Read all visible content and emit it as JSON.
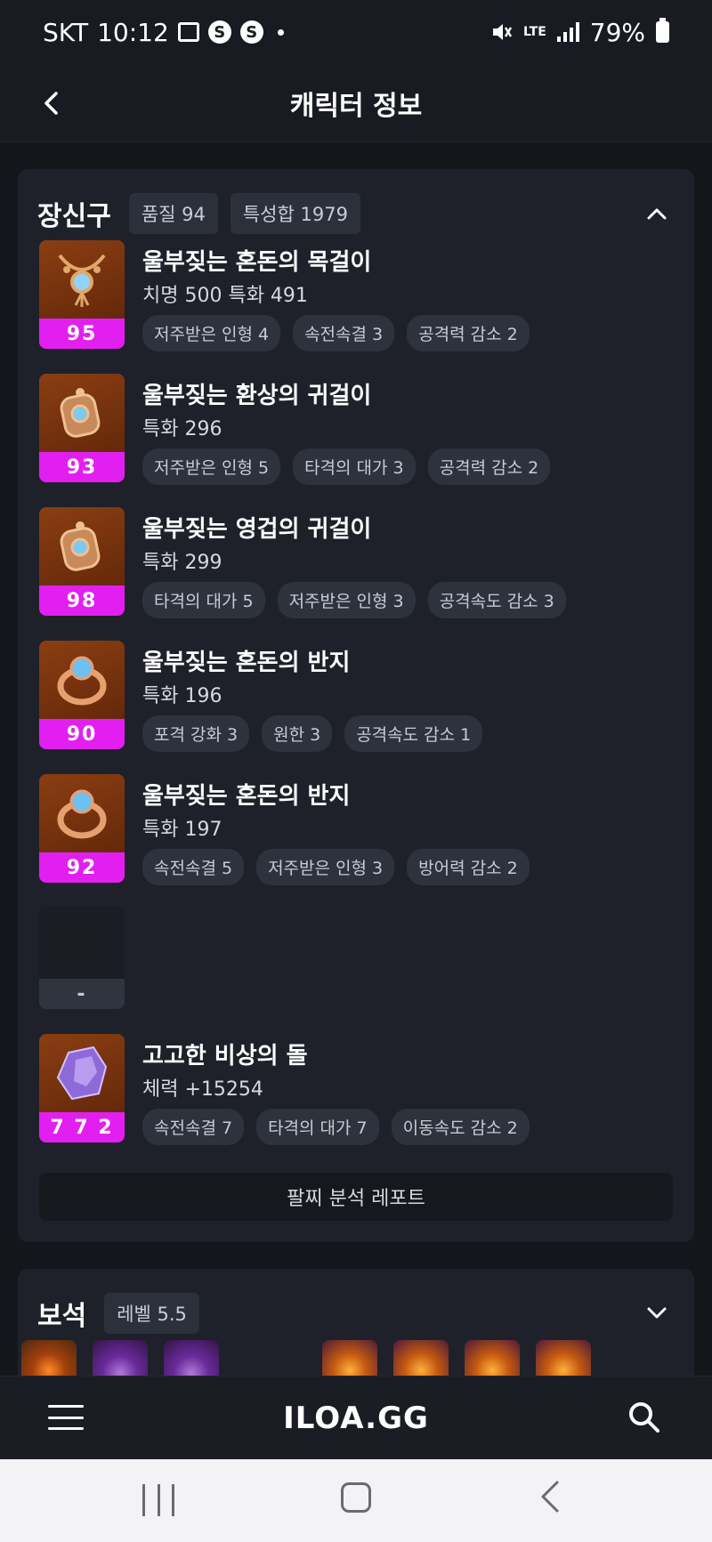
{
  "status_bar": {
    "carrier": "SKT",
    "time": "10:12",
    "icons": [
      "image-icon",
      "s-icon",
      "s-icon",
      "dot-icon"
    ],
    "right_icons": [
      "mute-icon",
      "lte-icon",
      "signal-icon"
    ],
    "lte_label": "LTE",
    "battery": "79%"
  },
  "header": {
    "back_icon": "chevron-left-icon",
    "title": "캐릭터 정보"
  },
  "equipment": {
    "title": "장신구",
    "quality_label": "품질 94",
    "sum_label": "특성합 1979",
    "collapse_icon": "chevron-up-icon",
    "items": [
      {
        "level": "95",
        "name": "울부짖는 혼돈의 목걸이",
        "stat": "치명 500  특화 491",
        "icon": "necklace-icon",
        "tags": [
          "저주받은 인형 4",
          "속전속결 3",
          "공격력 감소 2"
        ]
      },
      {
        "level": "93",
        "name": "울부짖는 환상의 귀걸이",
        "stat": "특화 296",
        "icon": "earring-icon",
        "tags": [
          "저주받은 인형 5",
          "타격의 대가 3",
          "공격력 감소 2"
        ]
      },
      {
        "level": "98",
        "name": "울부짖는 영겁의 귀걸이",
        "stat": "특화 299",
        "icon": "earring-icon",
        "tags": [
          "타격의 대가 5",
          "저주받은 인형 3",
          "공격속도 감소 3"
        ]
      },
      {
        "level": "90",
        "name": "울부짖는 혼돈의 반지",
        "stat": "특화 196",
        "icon": "ring-icon",
        "tags": [
          "포격 강화 3",
          "원한 3",
          "공격속도 감소 1"
        ]
      },
      {
        "level": "92",
        "name": "울부짖는 혼돈의 반지",
        "stat": "특화 197",
        "icon": "ring-icon",
        "tags": [
          "속전속결 5",
          "저주받은 인형 3",
          "방어력 감소 2"
        ]
      }
    ],
    "empty_slot_label": "-",
    "stone": {
      "level": "7 7 2",
      "name": "고고한 비상의 돌",
      "stat": "체력 +15254",
      "icon": "ability-stone-icon",
      "tags": [
        "속전속결 7",
        "타격의 대가 7",
        "이동속도 감소 2"
      ]
    },
    "report_button": "팔찌 분석 레포트"
  },
  "gems": {
    "title": "보석",
    "level_label": "레벨 5.5",
    "expand_icon": "chevron-down-icon"
  },
  "bottom_nav": {
    "menu_icon": "hamburger-icon",
    "logo": "ILOA.GG",
    "search_icon": "search-icon"
  },
  "android_nav": {
    "recent_icon": "recent-apps-icon",
    "home_icon": "home-icon",
    "back_icon": "back-icon"
  }
}
